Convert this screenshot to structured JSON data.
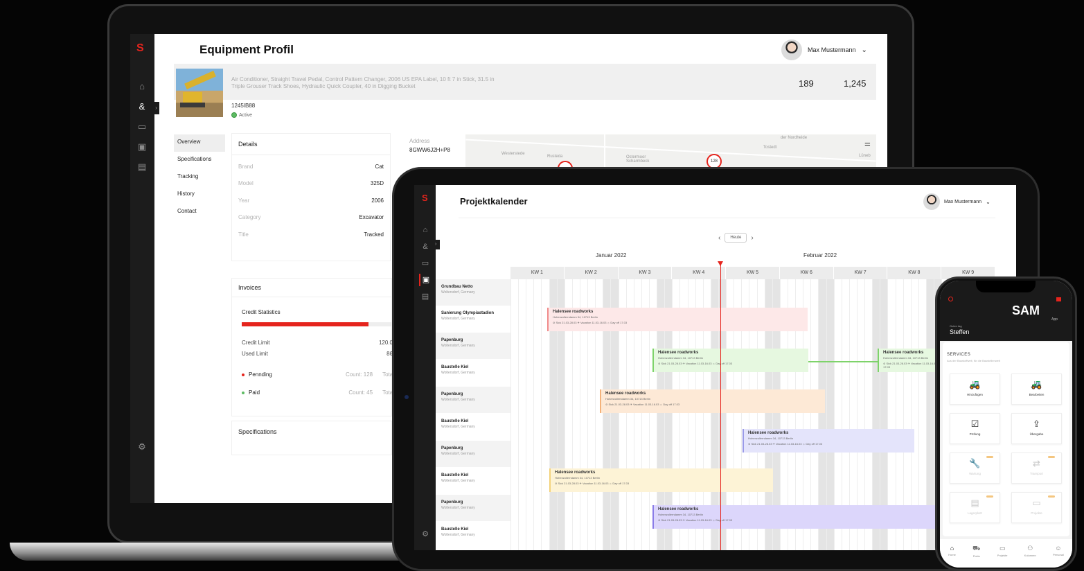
{
  "laptop": {
    "logo": "S",
    "title": "Equipment Profil",
    "user": {
      "name": "Max Mustermann"
    },
    "equipment": {
      "description": "Air Conditioner, Straight Travel Pedal, Control Pattern Changer, 2006 US EPA Label, 10 ft 7 in Stick, 31.5 in Triple Grouser Track Shoes, Hydraulic Quick Coupler, 40 in Digging Bucket",
      "stat_a": "189",
      "stat_b": "1,245",
      "id": "1245IB88",
      "status": "Active"
    },
    "tabs": [
      "Overview",
      "Specifications",
      "Tracking",
      "History",
      "Contact"
    ],
    "details": {
      "title": "Details",
      "rows": [
        {
          "k": "Brand",
          "v": "Cat"
        },
        {
          "k": "Model",
          "v": "325D"
        },
        {
          "k": "Year",
          "v": "2006"
        },
        {
          "k": "Category",
          "v": "Excavator"
        },
        {
          "k": "Title",
          "v": "Tracked"
        }
      ]
    },
    "invoices": {
      "title": "Invoices",
      "credit_statistics": "Credit Statistics",
      "credit_used_fraction": 0.84,
      "credit_limit_label": "Credit Limit",
      "credit_limit_value": "120.0",
      "used_limit_label": "Used  Limit",
      "used_limit_value": "86",
      "pending_label": "Pennding",
      "pending_count": "Count:  128",
      "paid_label": "Paid",
      "paid_count": "Count:  45",
      "total_label": "Total",
      "pending_color": "#e5241d",
      "paid_color": "#5dbb63"
    },
    "specifications_title": "Specifications",
    "address": {
      "label": "Address",
      "value": "8GWW6J2H+P8"
    },
    "map": {
      "labels": [
        "Westerstede",
        "Rusteda",
        "Ostermoor Scharmbeck",
        "der Nordheide",
        "Tostedt",
        "Lüneb"
      ],
      "marker": "128"
    }
  },
  "tablet": {
    "logo": "S",
    "title": "Projektkalender",
    "user": {
      "name": "Max Mustermann"
    },
    "today_button": "Heute",
    "months": [
      "Januar 2022",
      "Februar 2022"
    ],
    "weeks": [
      "KW 1",
      "KW 2",
      "KW 3",
      "KW 4",
      "KW 5",
      "KW 6",
      "KW 7",
      "KW 8",
      "KW 9"
    ],
    "resources": [
      {
        "name": "Grundbau Netto",
        "loc": "Woltersdorf, Germany"
      },
      {
        "name": "Sanierung Olympiastadion",
        "loc": "Woltersdorf, Germany"
      },
      {
        "name": "Papenburg",
        "loc": "Woltersdorf, Germany"
      },
      {
        "name": "Baustelle Kiel",
        "loc": "Woltersdorf, Germany"
      },
      {
        "name": "Papenburg",
        "loc": "Woltersdorf, Germany"
      },
      {
        "name": "Baustelle Kiel",
        "loc": "Woltersdorf, Germany"
      },
      {
        "name": "Papenburg",
        "loc": "Woltersdorf, Germany"
      },
      {
        "name": "Baustelle Kiel",
        "loc": "Woltersdorf, Germany"
      },
      {
        "name": "Papenburg",
        "loc": "Woltersdorf, Germany"
      },
      {
        "name": "Baustelle Kiel",
        "loc": "Woltersdorf, Germany"
      }
    ],
    "booking": {
      "title": "Halensee roadworks",
      "address": "Hohenzollerndamm 34, 10713 Berlin",
      "meta": "⊘ Sick 21.03-28.03   ✈ Vacation 11.03-16.03   ☼ Day off 17.03"
    },
    "bar_colors": {
      "red": "#fde8e8",
      "red_border": "#f08b8b",
      "green": "#e6f8e0",
      "green_border": "#7ed36a",
      "orange": "#fde9d6",
      "orange_border": "#f4b27a",
      "blue": "#e4e4fb",
      "blue_border": "#9a9ae8",
      "yellow": "#fdf3d6",
      "yellow_border": "#f3d27a",
      "purple": "#dcd6fb",
      "purple_border": "#8a7ce8"
    }
  },
  "phone": {
    "app_name": "SAM",
    "app_sub": "App",
    "greeting": "Guten tag",
    "user_name": "Steffen",
    "services_title": "SERVICES",
    "services_subtitle": "Aus der Baustoffwelt, für die Baustellenwelt",
    "tiles": [
      {
        "label": "Hinzufügen",
        "icon": "excavator-plus-icon",
        "glyph": "🚜",
        "disabled": false
      },
      {
        "label": "Bearbeiten",
        "icon": "excavator-edit-icon",
        "glyph": "🚜",
        "disabled": false
      },
      {
        "label": "Prüfung",
        "icon": "checklist-icon",
        "glyph": "☑",
        "disabled": false
      },
      {
        "label": "Übergabe",
        "icon": "handover-icon",
        "glyph": "⇪",
        "disabled": false
      },
      {
        "label": "Wartung",
        "icon": "wrench-icon",
        "glyph": "🔧",
        "disabled": true
      },
      {
        "label": "Transport",
        "icon": "transfer-icon",
        "glyph": "⇄",
        "disabled": true
      },
      {
        "label": "Lagerplatz",
        "icon": "storage-icon",
        "glyph": "▤",
        "disabled": true
      },
      {
        "label": "Projekte",
        "icon": "folder-icon",
        "glyph": "▭",
        "disabled": true
      }
    ],
    "tabbar": [
      {
        "label": "Home",
        "glyph": "⌂",
        "icon": "home-icon"
      },
      {
        "label": "Flotte",
        "glyph": "⛟",
        "icon": "fleet-icon"
      },
      {
        "label": "Projekte",
        "glyph": "▭",
        "icon": "folder-icon"
      },
      {
        "label": "Kolonnen",
        "glyph": "⚇",
        "icon": "team-icon"
      },
      {
        "label": "Personal",
        "glyph": "☺",
        "icon": "person-icon"
      }
    ]
  }
}
